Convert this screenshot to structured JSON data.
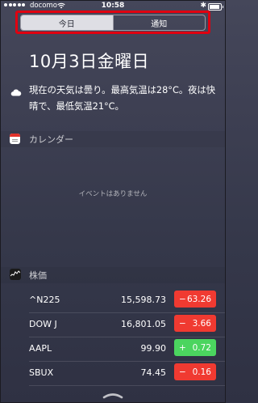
{
  "status": {
    "carrier": "docomo",
    "time": "10:58",
    "bluetooth": "✱",
    "battery_level": 0.8
  },
  "tabs": [
    {
      "label": "今日",
      "active": true
    },
    {
      "label": "通知",
      "active": false
    }
  ],
  "date": "10月3日金曜日",
  "weather": {
    "icon": "cloud-icon",
    "text": "現在の天気は曇り。最高気温は28°C。夜は快晴で、最低気温21°C。"
  },
  "calendar": {
    "title": "カレンダー",
    "empty": "イベントはありません"
  },
  "stocks": {
    "title": "株価",
    "items": [
      {
        "symbol": "^N225",
        "price": "15,598.73",
        "sign": "−",
        "change": "63.26",
        "direction": "down"
      },
      {
        "symbol": "DOW J",
        "price": "16,801.05",
        "sign": "−",
        "change": "3.66",
        "direction": "down"
      },
      {
        "symbol": "AAPL",
        "price": "99.90",
        "sign": "+",
        "change": "0.72",
        "direction": "up"
      },
      {
        "symbol": "SBUX",
        "price": "74.45",
        "sign": "−",
        "change": "0.16",
        "direction": "down"
      }
    ]
  },
  "colors": {
    "highlight": "#e00010",
    "down": "#f03a31",
    "up": "#4bd55f"
  }
}
